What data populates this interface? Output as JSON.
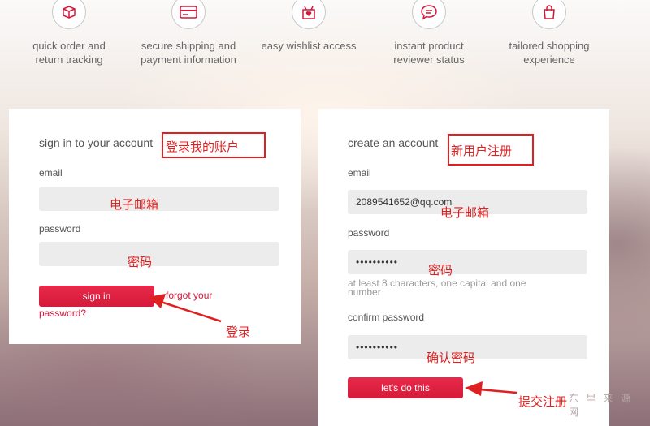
{
  "features": [
    {
      "icon": "box-icon",
      "line1": "quick order and",
      "line2": "return tracking"
    },
    {
      "icon": "credit-card-icon",
      "line1": "secure shipping and",
      "line2": "payment information"
    },
    {
      "icon": "gift-heart-icon",
      "line1": "easy wishlist access",
      "line2": ""
    },
    {
      "icon": "speech-bubble-icon",
      "line1": "instant product",
      "line2": "reviewer status"
    },
    {
      "icon": "shopping-bag-icon",
      "line1": "tailored shopping",
      "line2": "experience"
    }
  ],
  "signin": {
    "heading": "sign in to your account",
    "email_label": "email",
    "email_value": "",
    "password_label": "password",
    "password_value": "",
    "button": "sign in",
    "forgot_line1": "forgot your",
    "forgot_line2": "password?"
  },
  "register": {
    "heading": "create an account",
    "email_label": "email",
    "email_value": "2089541652@qq.com",
    "password_label": "password",
    "password_value": "••••••••••",
    "hint_line1": "at least 8 characters, one capital and one",
    "hint_line2": "number",
    "confirm_label": "confirm password",
    "confirm_value": "••••••••••",
    "button": "let's do this"
  },
  "annotations": {
    "signin_title": "登录我的账户",
    "signin_email": "电子邮箱",
    "signin_password": "密码",
    "signin_button": "登录",
    "register_title": "新用户注册",
    "register_email": "电子邮箱",
    "register_password": "密码",
    "register_confirm": "确认密码",
    "register_button": "提交注册"
  },
  "watermark": "东 里 来 源  网",
  "colors": {
    "accent": "#d51a3a",
    "annotation": "#e02020"
  }
}
